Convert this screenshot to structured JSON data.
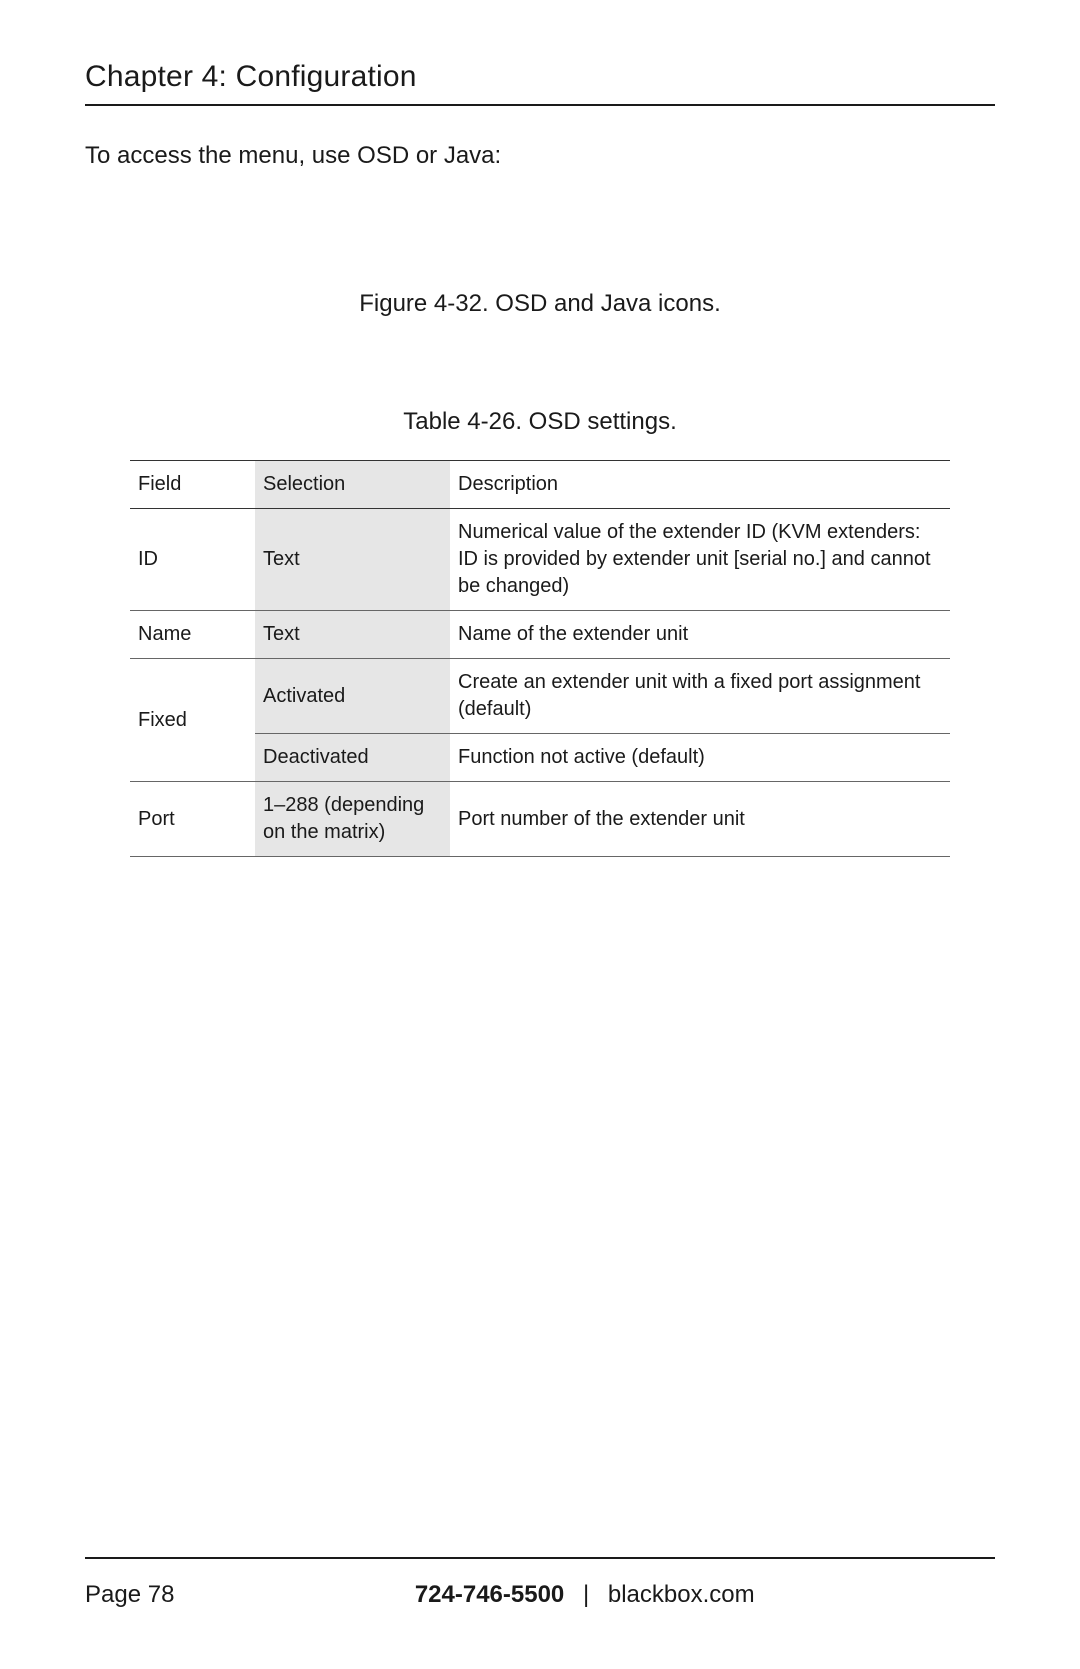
{
  "header": {
    "chapter_title": "Chapter 4: Configuration"
  },
  "body": {
    "intro": "To access the menu, use OSD or Java:",
    "figure_caption": "Figure 4-32. OSD and Java icons.",
    "table_caption": "Table 4-26. OSD settings."
  },
  "table": {
    "headers": {
      "field": "Field",
      "selection": "Selection",
      "description": "Description"
    },
    "rows": [
      {
        "field": "ID",
        "selection": "Text",
        "description": "Numerical value of the extender ID (KVM extenders: ID is provided by extender unit [serial no.] and cannot be changed)"
      },
      {
        "field": "Name",
        "selection": "Text",
        "description": "Name of the extender unit"
      },
      {
        "field": "Fixed",
        "selection": "Activated",
        "description": "Create an extender unit with a fixed port assignment (default)"
      },
      {
        "field": "",
        "selection": "Deactivated",
        "description": "Function not active (default)"
      },
      {
        "field": "Port",
        "selection": "1–288 (depending on the matrix)",
        "description": "Port number of the extender unit"
      }
    ]
  },
  "footer": {
    "page_label": "Page 78",
    "phone": "724-746-5500",
    "separator": "|",
    "site": "blackbox.com"
  }
}
